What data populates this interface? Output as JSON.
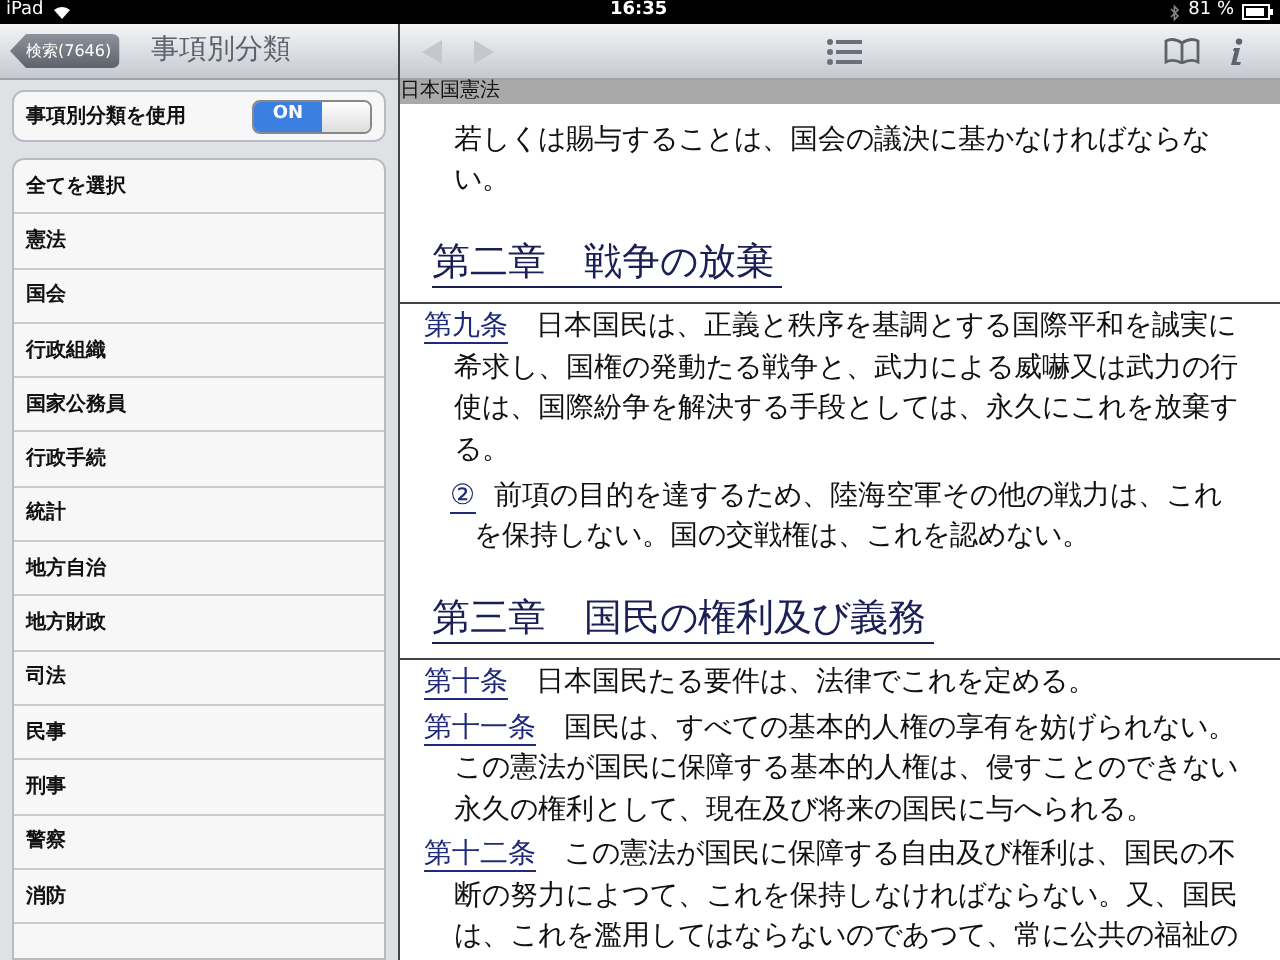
{
  "status_bar": {
    "device": "iPad",
    "time": "16:35",
    "battery": "81 %"
  },
  "sidebar": {
    "back_button": "検索(7646)",
    "title": "事項別分類",
    "toggle": {
      "label": "事項別分類を使用",
      "on": true,
      "value_text": "ON"
    },
    "items": [
      {
        "label": "全てを選択"
      },
      {
        "label": "憲法"
      },
      {
        "label": "国会"
      },
      {
        "label": "行政組織"
      },
      {
        "label": "国家公務員"
      },
      {
        "label": "行政手続"
      },
      {
        "label": "統計"
      },
      {
        "label": "地方自治"
      },
      {
        "label": "地方財政"
      },
      {
        "label": "司法"
      },
      {
        "label": "民事"
      },
      {
        "label": "刑事"
      },
      {
        "label": "警察"
      },
      {
        "label": "消防"
      }
    ]
  },
  "toolbar": {
    "back_disabled": true,
    "forward_disabled": true
  },
  "document": {
    "title": "日本国憲法",
    "blocks": [
      {
        "kind": "text",
        "text": "若しくは賜与することは、国会の議決に基かなければならない。"
      },
      {
        "kind": "heading",
        "text": "第二章　戦争の放棄"
      },
      {
        "kind": "article",
        "label": "第九条",
        "text": "日本国民は、正義と秩序を基調とする国際平和を誠実に希求し、国権の発動たる戦争と、武力による威嚇又は武力の行使は、国際紛争を解決する手段としては、永久にこれを放棄する。"
      },
      {
        "kind": "paragraph",
        "number": "②",
        "text": "前項の目的を達するため、陸海空軍その他の戦力は、これを保持しない。国の交戦権は、これを認めない。"
      },
      {
        "kind": "heading",
        "text": "第三章　国民の権利及び義務"
      },
      {
        "kind": "article",
        "label": "第十条",
        "text": "日本国民たる要件は、法律でこれを定める。"
      },
      {
        "kind": "article",
        "label": "第十一条",
        "text": "国民は、すべての基本的人権の享有を妨げられない。この憲法が国民に保障する基本的人権は、侵すことのできない永久の権利として、現在及び将来の国民に与へられる。"
      },
      {
        "kind": "article",
        "label": "第十二条",
        "text": "この憲法が国民に保障する自由及び権利は、国民の不断の努力によつて、これを保持しなければならない。又、国民は、これを濫用してはならないのであつて、常に公共の福祉の"
      }
    ]
  }
}
